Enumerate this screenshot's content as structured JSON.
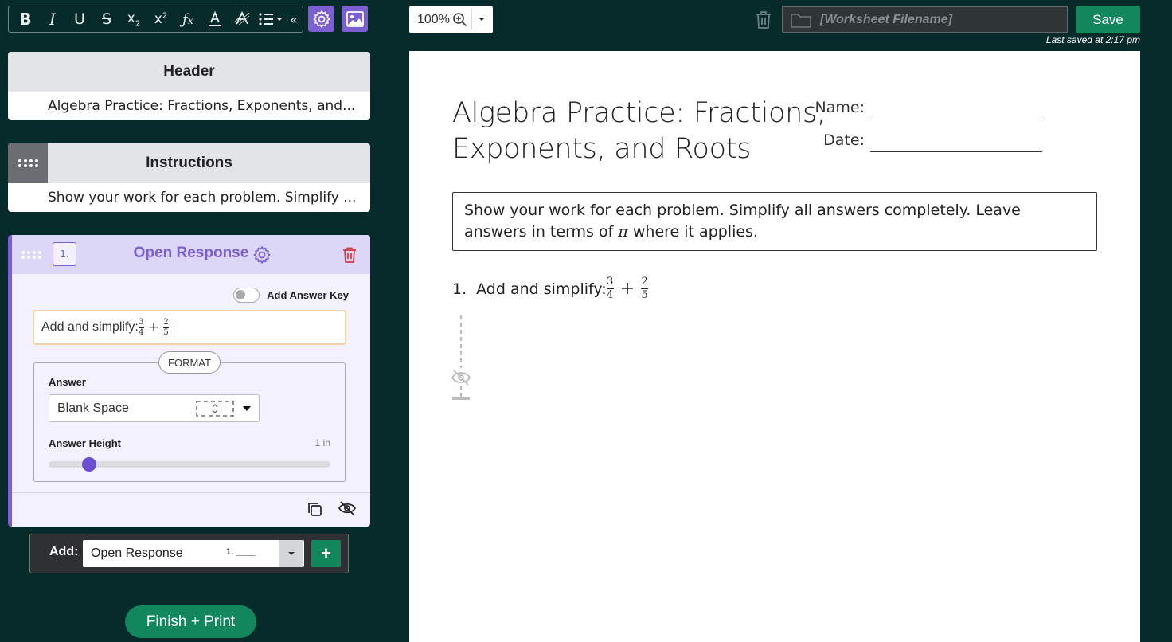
{
  "toolbar": {
    "buttons": [
      "bold",
      "italic",
      "underline",
      "strikethrough",
      "subscript",
      "superscript",
      "formula",
      "font-color",
      "highlight",
      "bullet-list"
    ],
    "collapse_glyph": "«",
    "accent_color": "#7b5fd3"
  },
  "header_panel": {
    "title": "Header",
    "value": "Algebra Practice: Fractions, Exponents, and..."
  },
  "instructions_panel": {
    "title": "Instructions",
    "value": "Show your work for each problem. Simplify ..."
  },
  "question_panel": {
    "number": "1.",
    "title": "Open Response",
    "answer_key_label": "Add Answer Key",
    "answer_key_enabled": false,
    "prompt_text": "Add and simplify: ",
    "fraction_a": {
      "num": "3",
      "den": "4"
    },
    "fraction_b": {
      "num": "2",
      "den": "5"
    },
    "operator": "+",
    "format_label": "FORMAT",
    "answer_label": "Answer",
    "answer_type": "Blank Space",
    "answer_height_label": "Answer Height",
    "answer_height_value": "1 in",
    "answer_height_fraction": 0.145
  },
  "add_bar": {
    "label": "Add:",
    "selected": "Open Response",
    "preview": "1. ____",
    "plus": "+"
  },
  "finish_button": "Finish + Print",
  "topbar": {
    "zoom": "100%",
    "filename_placeholder": "[Worksheet Filename]",
    "save_label": "Save",
    "last_saved": "Last saved at 2:17 pm"
  },
  "worksheet": {
    "title": "Algebra Practice: Fractions, Exponents, and Roots",
    "name_label": "Name:",
    "date_label": "Date:",
    "instructions_pre": "Show your work for each problem. Simplify all answers completely. Leave answers in terms of ",
    "pi": "π",
    "instructions_post": " where it applies.",
    "question_number": "1.",
    "question_text": "Add and simplify: "
  },
  "colors": {
    "background": "#072a2b",
    "accent": "#7b5fd3",
    "green": "#11875b",
    "danger": "#d43a46"
  }
}
